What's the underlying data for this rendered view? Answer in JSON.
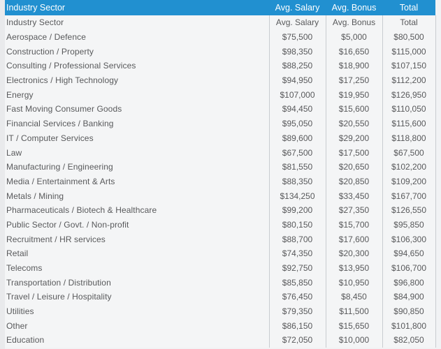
{
  "table": {
    "header": {
      "sector": "Industry Sector",
      "avg_salary": "Avg. Salary",
      "avg_bonus": "Avg. Bonus",
      "total": "Total"
    },
    "subheader": {
      "sector": "Industry Sector",
      "avg_salary": "Avg. Salary",
      "avg_bonus": "Avg. Bonus",
      "total": "Total"
    },
    "columns": [
      "Industry Sector",
      "Avg. Salary",
      "Avg. Bonus",
      "Total"
    ],
    "rows": [
      {
        "sector": "Aerospace / Defence",
        "avg_salary": "$75,500",
        "avg_bonus": "$5,000",
        "total": "$80,500"
      },
      {
        "sector": "Construction / Property",
        "avg_salary": "$98,350",
        "avg_bonus": "$16,650",
        "total": "$115,000"
      },
      {
        "sector": "Consulting / Professional Services",
        "avg_salary": "$88,250",
        "avg_bonus": "$18,900",
        "total": "$107,150"
      },
      {
        "sector": "Electronics / High Technology",
        "avg_salary": "$94,950",
        "avg_bonus": "$17,250",
        "total": "$112,200"
      },
      {
        "sector": "Energy",
        "avg_salary": "$107,000",
        "avg_bonus": "$19,950",
        "total": "$126,950"
      },
      {
        "sector": "Fast Moving Consumer Goods",
        "avg_salary": "$94,450",
        "avg_bonus": "$15,600",
        "total": "$110,050"
      },
      {
        "sector": "Financial Services / Banking",
        "avg_salary": "$95,050",
        "avg_bonus": "$20,550",
        "total": "$115,600"
      },
      {
        "sector": "IT / Computer Services",
        "avg_salary": "$89,600",
        "avg_bonus": "$29,200",
        "total": "$118,800"
      },
      {
        "sector": "Law",
        "avg_salary": "$67,500",
        "avg_bonus": "$17,500",
        "total": "$67,500"
      },
      {
        "sector": "Manufacturing / Engineering",
        "avg_salary": "$81,550",
        "avg_bonus": "$20,650",
        "total": "$102,200"
      },
      {
        "sector": "Media / Entertainment & Arts",
        "avg_salary": "$88,350",
        "avg_bonus": "$20,850",
        "total": "$109,200"
      },
      {
        "sector": "Metals / Mining",
        "avg_salary": "$134,250",
        "avg_bonus": "$33,450",
        "total": "$167,700"
      },
      {
        "sector": "Pharmaceuticals / Biotech & Healthcare",
        "avg_salary": "$99,200",
        "avg_bonus": "$27,350",
        "total": "$126,550"
      },
      {
        "sector": "Public Sector / Govt. / Non-profit",
        "avg_salary": "$80,150",
        "avg_bonus": "$15,700",
        "total": "$95,850"
      },
      {
        "sector": "Recruitment / HR services",
        "avg_salary": "$88,700",
        "avg_bonus": "$17,600",
        "total": "$106,300"
      },
      {
        "sector": "Retail",
        "avg_salary": "$74,350",
        "avg_bonus": "$20,300",
        "total": "$94,650"
      },
      {
        "sector": "Telecoms",
        "avg_salary": "$92,750",
        "avg_bonus": "$13,950",
        "total": "$106,700"
      },
      {
        "sector": "Transportation / Distribution",
        "avg_salary": "$85,850",
        "avg_bonus": "$10,950",
        "total": "$96,800"
      },
      {
        "sector": "Travel / Leisure / Hospitality",
        "avg_salary": "$76,450",
        "avg_bonus": "$8,450",
        "total": "$84,900"
      },
      {
        "sector": "Utilities",
        "avg_salary": "$79,350",
        "avg_bonus": "$11,500",
        "total": "$90,850"
      },
      {
        "sector": "Other",
        "avg_salary": "$86,150",
        "avg_bonus": "$15,650",
        "total": "$101,800"
      },
      {
        "sector": "Education",
        "avg_salary": "$72,050",
        "avg_bonus": "$10,000",
        "total": "$82,050"
      }
    ]
  },
  "colors": {
    "header_bar": "#2190d0",
    "header_text": "#ffffff",
    "row_text": "#58595b",
    "row_background": "#f4f5f6",
    "divider": "#c9ccd0",
    "page_background": "#f1f2f4"
  }
}
